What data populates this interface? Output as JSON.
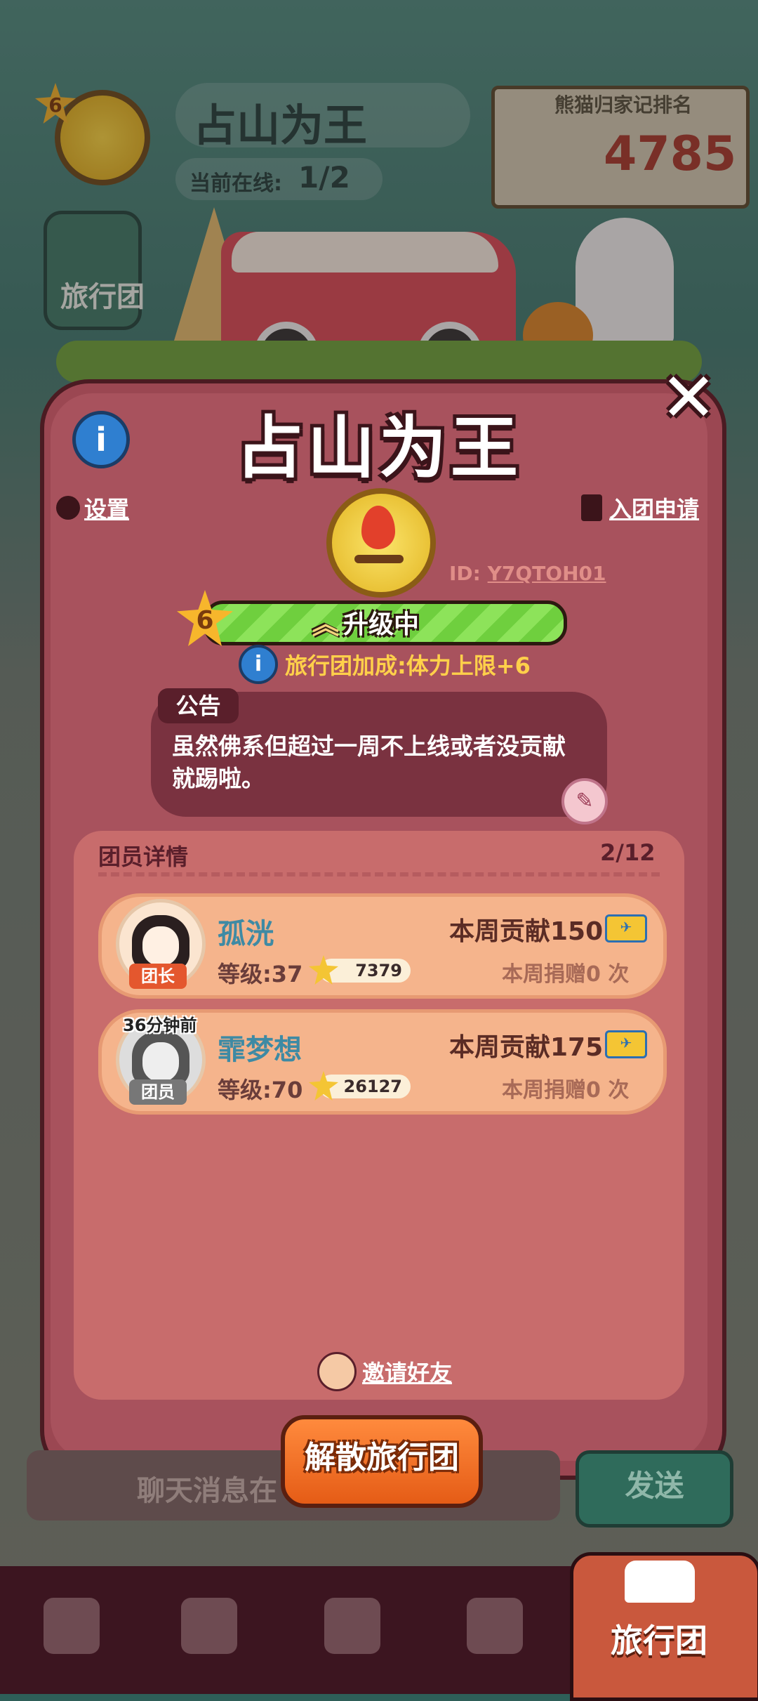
{
  "background": {
    "team_name": "占山为王",
    "online_label": "当前在线:",
    "online_value": "1/2",
    "level_badge": "6",
    "rank_title": "熊猫归家记排名",
    "rank_value": "4785",
    "left_button_label": "旅行团"
  },
  "modal": {
    "title": "占山为王",
    "settings_label": "设置",
    "join_requests_label": "入团申请",
    "id_prefix": "ID:",
    "id_value": "Y7QTOH01",
    "level": "6",
    "level_status": "升级中",
    "bonus_text": "旅行团加成:体力上限+6",
    "notice_tab": "公告",
    "notice_text": "虽然佛系但超过一周不上线或者没贡献就踢啦。",
    "members_header": "团员详情",
    "members_count": "2/12",
    "members": [
      {
        "name": "孤洸",
        "role": "团长",
        "level": "等级:37",
        "stars": "7379",
        "weekly_contribution": "本周贡献150",
        "weekly_donation": "本周捐赠0 次",
        "time_ago": ""
      },
      {
        "name": "霏梦想",
        "role": "团员",
        "level": "等级:70",
        "stars": "26127",
        "weekly_contribution": "本周贡献175",
        "weekly_donation": "本周捐赠0 次",
        "time_ago": "36分钟前"
      }
    ],
    "invite_label": "邀请好友",
    "disband_label": "解散旅行团"
  },
  "chat": {
    "placeholder": "聊天消息在",
    "send_label": "发送"
  },
  "tabbar": {
    "active_label": "旅行团",
    "icons": [
      "bag-icon",
      "cards-icon",
      "service-bell-icon",
      "map-pin-icon",
      "bus-icon"
    ]
  },
  "colors": {
    "modal_bg": "#9b4752",
    "member_card": "#f5b48c",
    "accent_orange": "#e55c16",
    "accent_gold": "#ffd04a"
  }
}
